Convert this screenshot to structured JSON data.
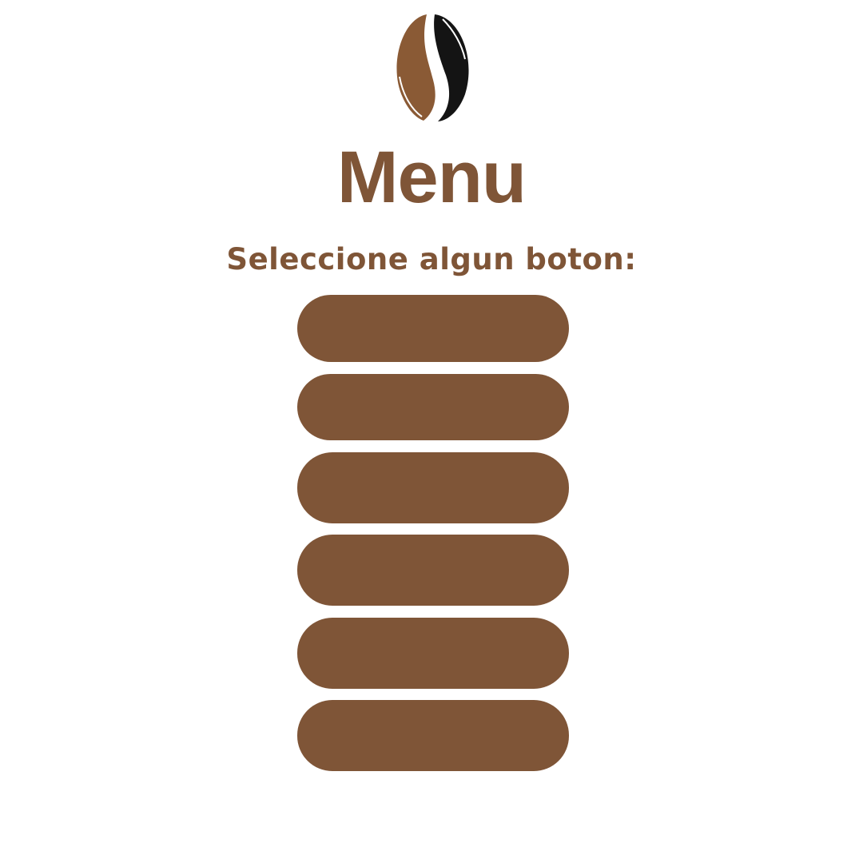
{
  "colors": {
    "accent": "#7f5537",
    "logo_light": "#8a5a35",
    "logo_dark": "#141414",
    "background": "#ffffff"
  },
  "header": {
    "logo_icon": "coffee-bean-icon",
    "title": "Menu",
    "subtitle": "Seleccione algun boton:"
  },
  "menu": {
    "buttons": [
      {
        "label": ""
      },
      {
        "label": ""
      },
      {
        "label": ""
      },
      {
        "label": ""
      },
      {
        "label": ""
      },
      {
        "label": ""
      }
    ]
  }
}
